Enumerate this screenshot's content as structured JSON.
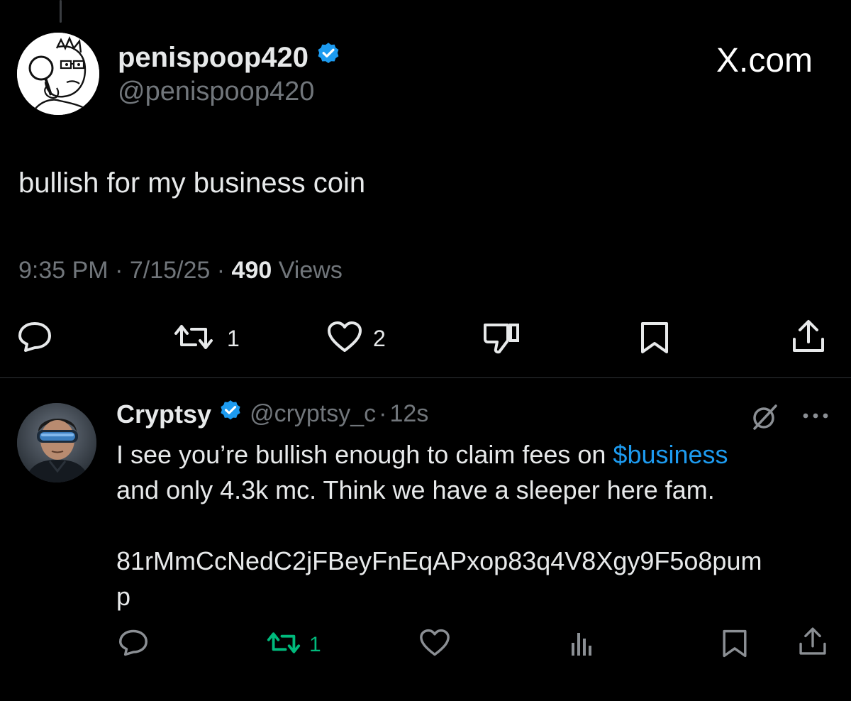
{
  "main_post": {
    "author_name": "penispoop420",
    "author_handle": "@penispoop420",
    "site_label": "X.com",
    "text": "bullish for my business coin",
    "time": "9:35 PM",
    "date": "7/15/25",
    "separator": "·",
    "views_count": "490",
    "views_label": "Views",
    "retweet_count": "1",
    "like_count": "2"
  },
  "reply": {
    "author_name": "Cryptsy",
    "author_handle": "@cryptsy_c",
    "separator": "·",
    "time_ago": "12s",
    "text_before_tag": "I see you’re bullish enough to claim fees on ",
    "cashtag": "$business",
    "text_line2": "and only 4.3k mc. Think we have a sleeper here fam.",
    "contract_line1": "81rMmCcNedC2jFBeyFnEqAPxop83q4V8Xgy9F5o8pum",
    "contract_line2": "p",
    "retweet_count": "1"
  },
  "icons": {
    "verified": "verified-badge-icon",
    "reply": "reply-bubble-icon",
    "retweet": "retweet-icon",
    "like": "heart-icon",
    "dislike": "thumbs-down-icon",
    "bookmark": "bookmark-icon",
    "share": "share-icon",
    "views": "analytics-bars-icon",
    "grok": "grok-icon",
    "more": "more-dots-icon"
  },
  "colors": {
    "background": "#000000",
    "text_primary": "#e7e9ea",
    "text_secondary": "#71767b",
    "verified_blue": "#1d9bf0",
    "cashtag_blue": "#1d9bf0",
    "retweet_active_green": "#00ba7c",
    "divider": "#2f3336"
  }
}
